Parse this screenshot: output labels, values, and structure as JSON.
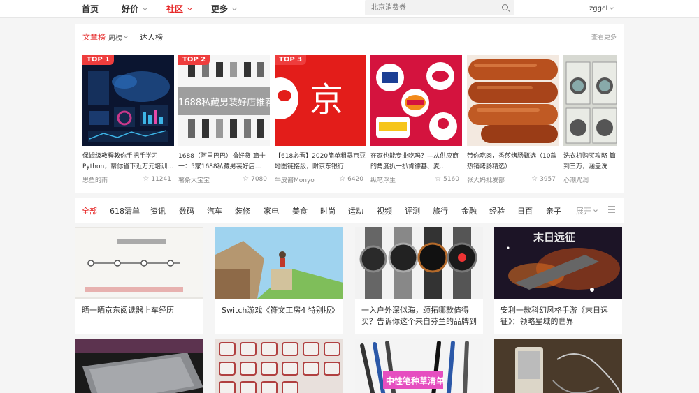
{
  "nav": {
    "home": "首页",
    "deals": "好价",
    "community": "社区",
    "more": "更多",
    "search_placeholder": "北京消费券",
    "user": "zggcl"
  },
  "rank_panel": {
    "tab_articles": "文章榜",
    "tab_weekly": "周榜",
    "tab_talent": "达人榜",
    "see_more": "查看更多",
    "items": [
      {
        "badge": "TOP 1",
        "title": "保姆级教程教你手把手学习Python，帮你省下近万元培训…",
        "author": "思鱼的雨",
        "stars": "11241"
      },
      {
        "badge": "TOP 2",
        "title": "1688（阿里巴巴）撸好货 篇十一：5家1688私藏男装好店…",
        "author": "薯条大宝宝",
        "stars": "7080",
        "img_text": "1688私藏男装好店推荐"
      },
      {
        "badge": "TOP 3",
        "title": "【618必看】2020简单粗暴京豆地图链接版，附京东银行…",
        "author": "牛皮酱Monyo",
        "stars": "6420",
        "img_text": "京"
      },
      {
        "title": "在家也能专业吃吗？—从供应商的角度扒一扒肯德基、麦…",
        "author": "纵笔浮生",
        "stars": "5160"
      },
      {
        "title": "带你吃肉，香煎烤肠甄选（10款热销烤肠精选）",
        "author": "张大妈批发部",
        "stars": "3957"
      },
      {
        "title": "洗衣机购买攻略 篇到三万，涵盖洗烘…",
        "author": "心潮咒润"
      }
    ]
  },
  "categories": {
    "items": [
      "全部",
      "618清单",
      "资讯",
      "数码",
      "汽车",
      "装修",
      "家电",
      "美食",
      "时尚",
      "运动",
      "视频",
      "评测",
      "旅行",
      "金融",
      "经验",
      "日百",
      "亲子"
    ],
    "expand": "展开"
  },
  "feed": [
    {
      "title": "晒一晒京东阅读器上车经历"
    },
    {
      "title": "Switch游戏《符文工房4 特别版》"
    },
    {
      "title": "一入户外深似海，颂拓哪款值得买？告诉你这个来自芬兰的品牌到"
    },
    {
      "title": "安利一款科幻风格手游《末日远征》：领略星域的世界",
      "img_text": "末日远征"
    },
    {
      "title": ""
    },
    {
      "title": ""
    },
    {
      "title": "",
      "img_text": "中性笔种草清单"
    },
    {
      "title": ""
    }
  ],
  "colors": {
    "accent": "#e62828",
    "badge": "#ee3d3d"
  }
}
